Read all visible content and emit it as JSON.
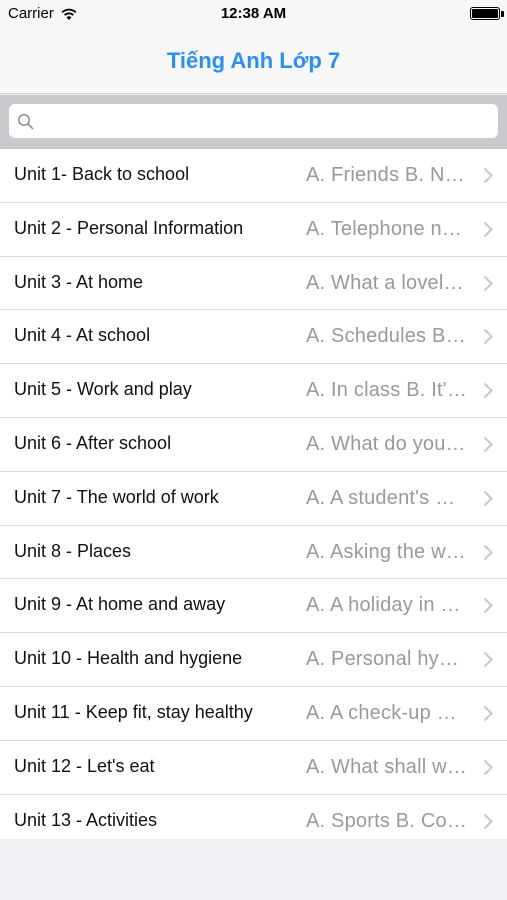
{
  "status": {
    "carrier": "Carrier",
    "time": "12:38 AM"
  },
  "nav": {
    "title": "Tiếng Anh Lớp 7"
  },
  "search": {
    "placeholder": ""
  },
  "units": [
    {
      "title": "Unit 1- Back to school",
      "detail": "A. Friends  B. Names and addresses"
    },
    {
      "title": "Unit 2 - Personal Information",
      "detail": "A. Telephone numbers  B. My birthday"
    },
    {
      "title": "Unit 3 - At home",
      "detail": "A. What a lovely home!  B. Hoa's family"
    },
    {
      "title": "Unit 4 - At school",
      "detail": "A. Schedules  B. The library"
    },
    {
      "title": "Unit 5 - Work and play",
      "detail": "A. In class   B. It's time for recess"
    },
    {
      "title": "Unit 6 - After school",
      "detail": "A. What do you do?  B. Let's go!"
    },
    {
      "title": "Unit 7 - The world of work",
      "detail": "A. A student's work  B. The worker"
    },
    {
      "title": "Unit 8 - Places",
      "detail": "A. Asking the way  B. At the post office"
    },
    {
      "title": "Unit 9 - At home and away",
      "detail": "A. A holiday in Nha Trang  B. Neighbors"
    },
    {
      "title": "Unit 10 - Health and hygiene",
      "detail": "A. Personal hygiene  B. A bad toothache"
    },
    {
      "title": "Unit 11 - Keep fit, stay healthy",
      "detail": "A. A check-up  B. What was wrong with you?"
    },
    {
      "title": "Unit 12 - Let's eat",
      "detail": "A. What shall we eat?  B. Our food"
    },
    {
      "title": "Unit 13 - Activities",
      "detail": "A. Sports   B. Come and play"
    }
  ]
}
